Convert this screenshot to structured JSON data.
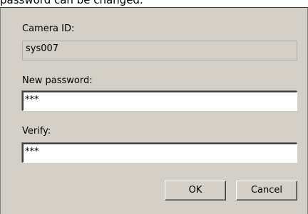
{
  "header": {
    "caption": "password can be changed."
  },
  "form": {
    "camera_id": {
      "label": "Camera ID:",
      "value": "sys007"
    },
    "new_password": {
      "label": "New password:",
      "value": "***"
    },
    "verify": {
      "label": "Verify:",
      "value": "***"
    }
  },
  "buttons": {
    "ok_label": "OK",
    "cancel_label": "Cancel"
  },
  "colors": {
    "dialog_background": "#d4d0c8",
    "field_background": "#ffffff"
  }
}
